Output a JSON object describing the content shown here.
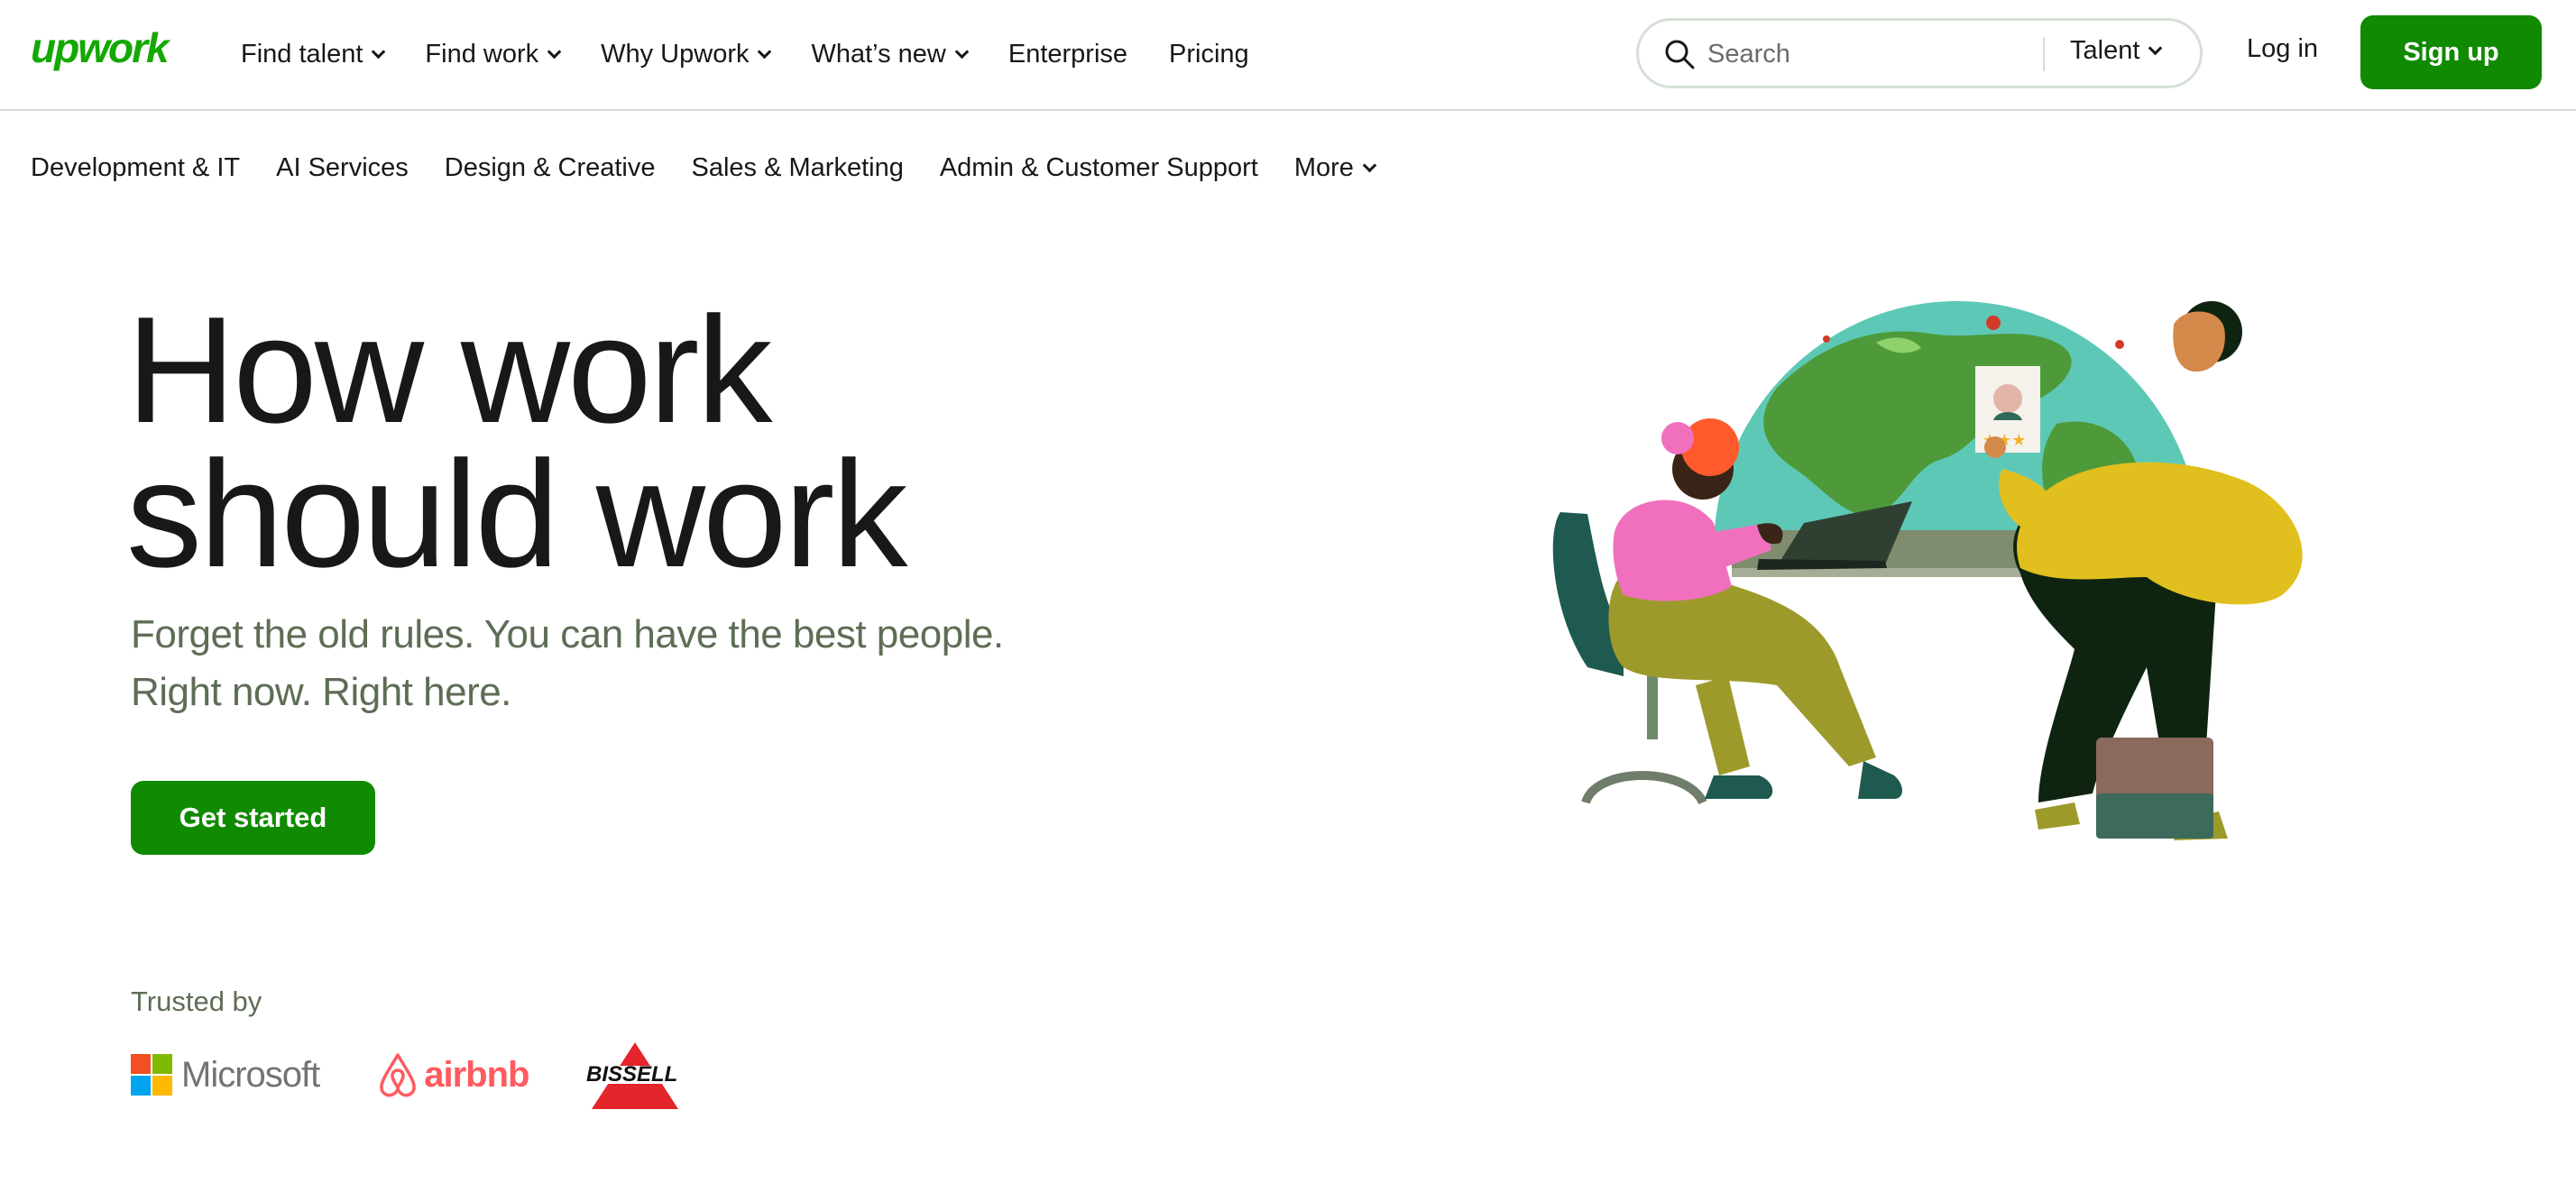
{
  "brand": {
    "logo_text": "upwork",
    "color": "#14a800"
  },
  "nav": {
    "items": [
      {
        "label": "Find talent",
        "dropdown": true
      },
      {
        "label": "Find work",
        "dropdown": true
      },
      {
        "label": "Why Upwork",
        "dropdown": true
      },
      {
        "label": "What’s new",
        "dropdown": true
      },
      {
        "label": "Enterprise",
        "dropdown": false
      },
      {
        "label": "Pricing",
        "dropdown": false
      }
    ]
  },
  "search": {
    "placeholder": "Search",
    "scope": "Talent"
  },
  "auth": {
    "login_label": "Log in",
    "signup_label": "Sign up"
  },
  "categories": [
    "Development & IT",
    "AI Services",
    "Design & Creative",
    "Sales & Marketing",
    "Admin & Customer Support",
    "More"
  ],
  "hero": {
    "headline_line1": "How work",
    "headline_line2": "should work",
    "subhead_line1": "Forget the old rules. You can have the best people.",
    "subhead_line2": "Right now. Right here.",
    "cta_label": "Get started"
  },
  "trusted": {
    "label": "Trusted by",
    "logos": [
      "Microsoft",
      "airbnb",
      "Bissell"
    ]
  },
  "colors": {
    "primary_button": "#108a00",
    "text": "#181818",
    "muted_text": "#5e6d55"
  }
}
